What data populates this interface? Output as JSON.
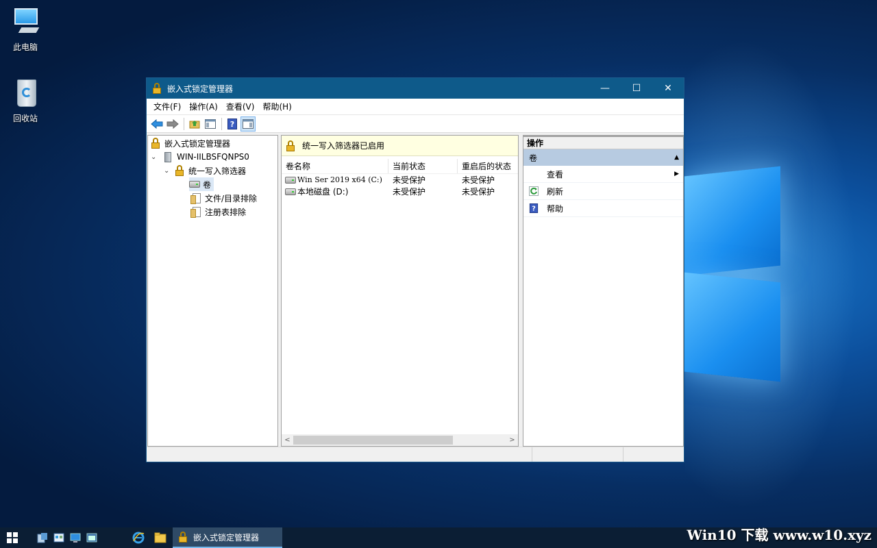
{
  "desktop": {
    "icons": [
      {
        "label": "此电脑",
        "icon": "computer-icon"
      },
      {
        "label": "回收站",
        "icon": "recycle-bin-icon"
      }
    ],
    "watermark": "Win10 下载 www.w10.xyz"
  },
  "window": {
    "title": "嵌入式锁定管理器",
    "controls": {
      "minimize": "—",
      "maximize": "☐",
      "close": "✕"
    },
    "menu": [
      "文件(F)",
      "操作(A)",
      "查看(V)",
      "帮助(H)"
    ],
    "toolbar": [
      "back-arrow-icon",
      "forward-arrow-icon",
      "up-folder-icon",
      "show-hide-tree-icon",
      "help-icon",
      "show-hide-action-pane-icon"
    ]
  },
  "tree": {
    "root": "嵌入式锁定管理器",
    "computer": "WIN-IILBSFQNPS0",
    "filter": "统一写入筛选器",
    "volumes": "卷",
    "file_exclusions": "文件/目录排除",
    "registry_exclusions": "注册表排除"
  },
  "center": {
    "banner": "统一写入筛选器已启用",
    "columns": [
      "卷名称",
      "当前状态",
      "重启后的状态"
    ],
    "rows": [
      {
        "name": "Win Ser 2019 x64 (C:)",
        "current": "未受保护",
        "after_restart": "未受保护"
      },
      {
        "name": "本地磁盘 (D:)",
        "current": "未受保护",
        "after_restart": "未受保护"
      }
    ],
    "scroll_fraction": 0.75
  },
  "actions": {
    "header": "操作",
    "section": "卷",
    "items": [
      "查看",
      "刷新",
      "帮助"
    ]
  },
  "taskbar": {
    "active_task": "嵌入式锁定管理器"
  }
}
